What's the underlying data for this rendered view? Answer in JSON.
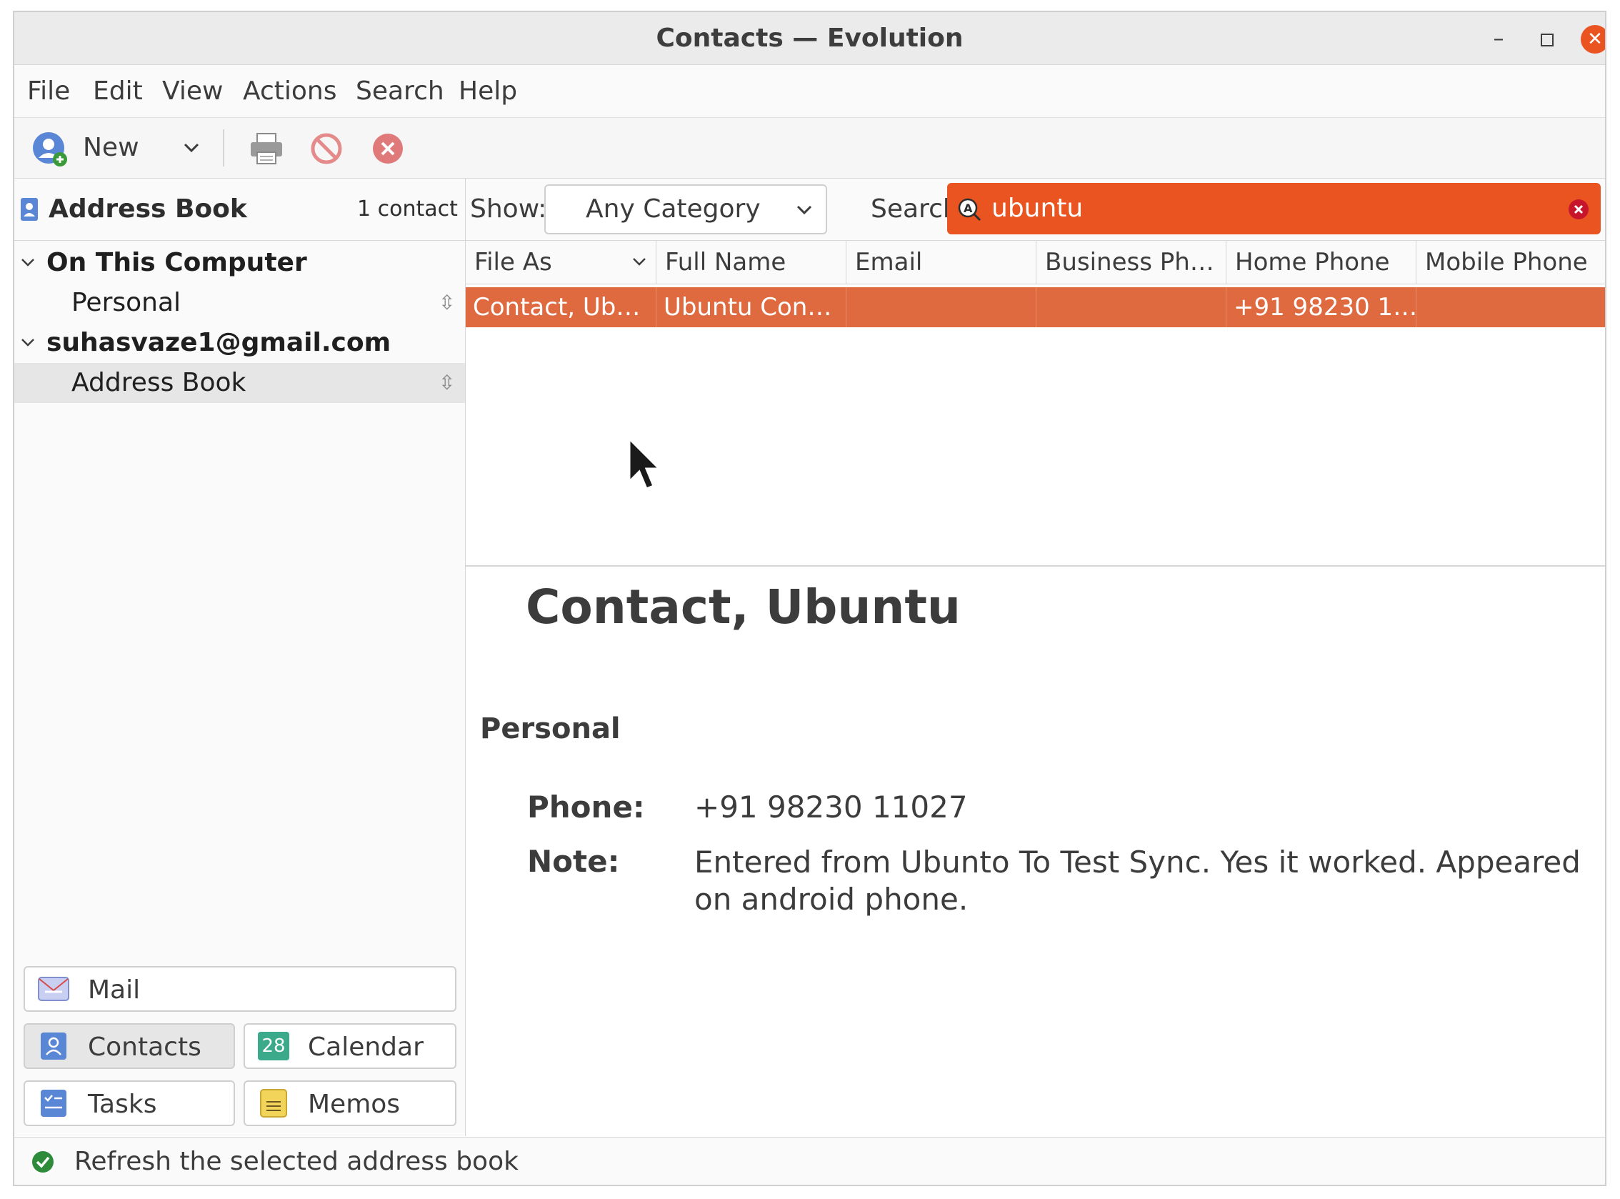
{
  "window": {
    "title": "Contacts — Evolution"
  },
  "menu": [
    "File",
    "Edit",
    "View",
    "Actions",
    "Search",
    "Help"
  ],
  "toolbar": {
    "new_label": "New"
  },
  "sidebar": {
    "title": "Address Book",
    "count": "1 contact",
    "groups": [
      {
        "label": "On This Computer",
        "items": [
          "Personal"
        ]
      },
      {
        "label": "suhasvaze1@gmail.com",
        "items": [
          "Address Book"
        ]
      }
    ]
  },
  "switcher": {
    "mail": "Mail",
    "contacts": "Contacts",
    "calendar": "Calendar",
    "calendar_day": "28",
    "tasks": "Tasks",
    "memos": "Memos"
  },
  "filter": {
    "show_label": "Show:",
    "category_value": "Any Category",
    "search_label": "Search:",
    "search_value": "ubuntu"
  },
  "table": {
    "columns": [
      "File As",
      "Full Name",
      "Email",
      "Business Ph…",
      "Home Phone",
      "Mobile Phone"
    ],
    "rows": [
      [
        "Contact, Ub…",
        "Ubuntu Con…",
        "",
        "",
        "+91 98230 1…",
        ""
      ]
    ]
  },
  "preview": {
    "name": "Contact, Ubuntu",
    "section": "Personal",
    "phone_label": "Phone:",
    "phone_value": "+91 98230 11027",
    "note_label": "Note:",
    "note_value": "Entered from Ubunto To Test Sync. Yes it worked. Appeared on android phone."
  },
  "status": {
    "text": "Refresh the selected address book"
  },
  "colors": {
    "accent": "#e95420",
    "selected_row": "#df6a40",
    "status_ok": "#2e8b3a"
  }
}
